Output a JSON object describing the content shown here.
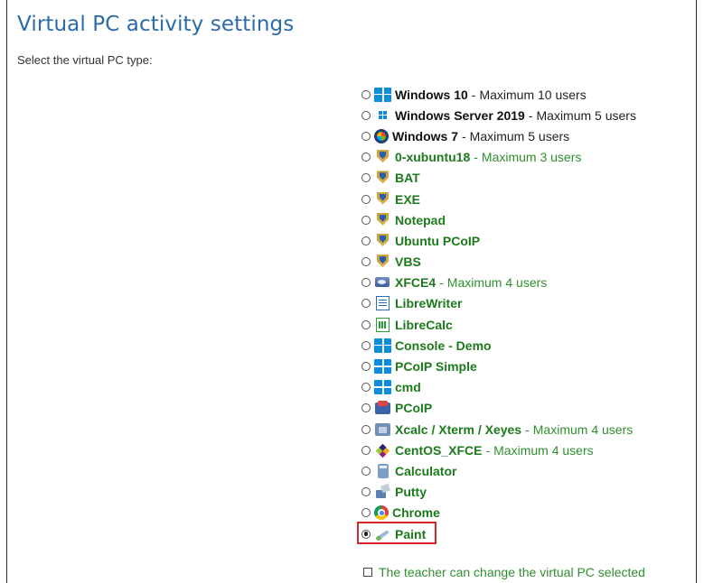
{
  "page": {
    "title": "Virtual PC activity settings",
    "subtitle": "Select the virtual PC type:"
  },
  "options": [
    {
      "name": "Windows 10",
      "extra": "Maximum 10 users",
      "style": "black",
      "icon": "windows-icon",
      "checked": false
    },
    {
      "name": "Windows Server 2019",
      "extra": "Maximum 5 users",
      "style": "black",
      "icon": "windows-server-icon",
      "checked": false
    },
    {
      "name": "Windows 7",
      "extra": "Maximum 5 users",
      "style": "black",
      "icon": "windows7-icon",
      "checked": false
    },
    {
      "name": "0-xubuntu18",
      "extra": "Maximum 3 users",
      "style": "green",
      "icon": "shield-icon",
      "checked": false
    },
    {
      "name": "BAT",
      "extra": "",
      "style": "green",
      "icon": "shield-icon",
      "checked": false
    },
    {
      "name": "EXE",
      "extra": "",
      "style": "green",
      "icon": "shield-icon",
      "checked": false
    },
    {
      "name": "Notepad",
      "extra": "",
      "style": "green",
      "icon": "shield-icon",
      "checked": false
    },
    {
      "name": "Ubuntu PCoIP",
      "extra": "",
      "style": "green",
      "icon": "shield-icon",
      "checked": false
    },
    {
      "name": "VBS",
      "extra": "",
      "style": "green",
      "icon": "shield-icon",
      "checked": false
    },
    {
      "name": "XFCE4",
      "extra": "Maximum 4 users",
      "style": "green",
      "icon": "xfce-icon",
      "checked": false
    },
    {
      "name": "LibreWriter",
      "extra": "",
      "style": "green",
      "icon": "document-icon",
      "checked": false
    },
    {
      "name": "LibreCalc",
      "extra": "",
      "style": "green",
      "icon": "spreadsheet-icon",
      "checked": false
    },
    {
      "name": "Console - Demo",
      "extra": "",
      "style": "green",
      "icon": "windows-icon",
      "checked": false
    },
    {
      "name": "PCoIP Simple",
      "extra": "",
      "style": "green",
      "icon": "windows-icon",
      "checked": false
    },
    {
      "name": "cmd",
      "extra": "",
      "style": "green",
      "icon": "windows-icon",
      "checked": false
    },
    {
      "name": "PCoIP",
      "extra": "",
      "style": "green",
      "icon": "pcoip-icon",
      "checked": false
    },
    {
      "name": "Xcalc / Xterm / Xeyes",
      "extra": "Maximum 4 users",
      "style": "green",
      "icon": "xcalc-icon",
      "checked": false
    },
    {
      "name": "CentOS_XFCE",
      "extra": "Maximum 4 users",
      "style": "green",
      "icon": "centos-icon",
      "checked": false
    },
    {
      "name": "Calculator",
      "extra": "",
      "style": "green",
      "icon": "calculator-icon",
      "checked": false
    },
    {
      "name": "Putty",
      "extra": "",
      "style": "green",
      "icon": "putty-icon",
      "checked": false
    },
    {
      "name": "Chrome",
      "extra": "",
      "style": "green",
      "icon": "chrome-icon",
      "checked": false
    },
    {
      "name": "Paint",
      "extra": "",
      "style": "green",
      "icon": "paint-icon",
      "checked": true,
      "highlighted": true
    }
  ],
  "teacher_option": {
    "label": "The teacher can change the virtual PC selected",
    "checked": false
  },
  "colors": {
    "title": "#2d6aa8",
    "green_text": "#1c7a1c",
    "highlight_border": "#d9262a"
  }
}
